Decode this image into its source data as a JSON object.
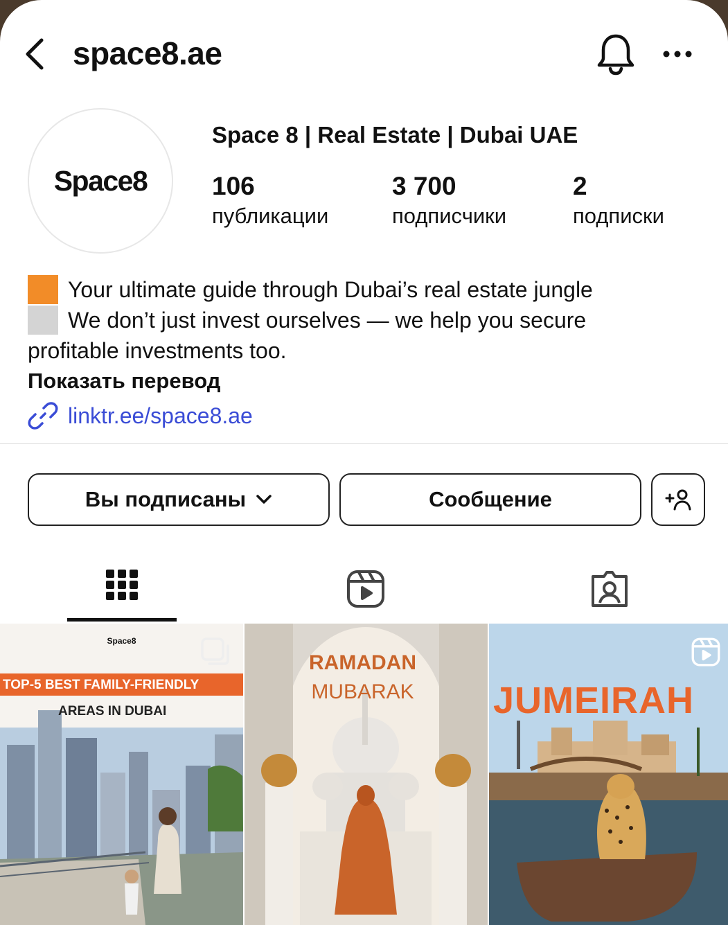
{
  "header": {
    "username": "space8.ae"
  },
  "profile": {
    "avatar_text": "Space8",
    "full_name": "Space 8 | Real Estate | Dubai UAE",
    "stats": [
      {
        "count": "106",
        "label": "публикации"
      },
      {
        "count": "3 700",
        "label": "подписчики"
      },
      {
        "count": "2",
        "label": "подписки"
      }
    ],
    "bio": {
      "line1": "Your ultimate guide through Dubai’s real estate jungle",
      "line2": "We don’t just invest ourselves — we help you secure",
      "line3": "profitable investments too.",
      "emoji_colors": [
        "#f28c28",
        "#d4d4d4"
      ]
    },
    "show_translation": "Показать перевод",
    "link": "linktr.ee/space8.ae"
  },
  "actions": {
    "following_label": "Вы подписаны",
    "message_label": "Сообщение"
  },
  "tabs": [
    {
      "icon": "grid-icon",
      "active": true
    },
    {
      "icon": "reels-icon",
      "active": false
    },
    {
      "icon": "tagged-icon",
      "active": false
    }
  ],
  "posts": [
    {
      "brand": "Space8",
      "banner": "TOP-5 BEST FAMILY-FRIENDLY",
      "subtitle": "AREAS IN DUBAI",
      "badge": "carousel-icon",
      "accent": "#e8652b"
    },
    {
      "title1": "RAMADAN",
      "title2": "MUBARAK",
      "accent": "#c9642a"
    },
    {
      "title": "JUMEIRAH",
      "badge": "reels-icon",
      "accent": "#e8652b"
    }
  ]
}
